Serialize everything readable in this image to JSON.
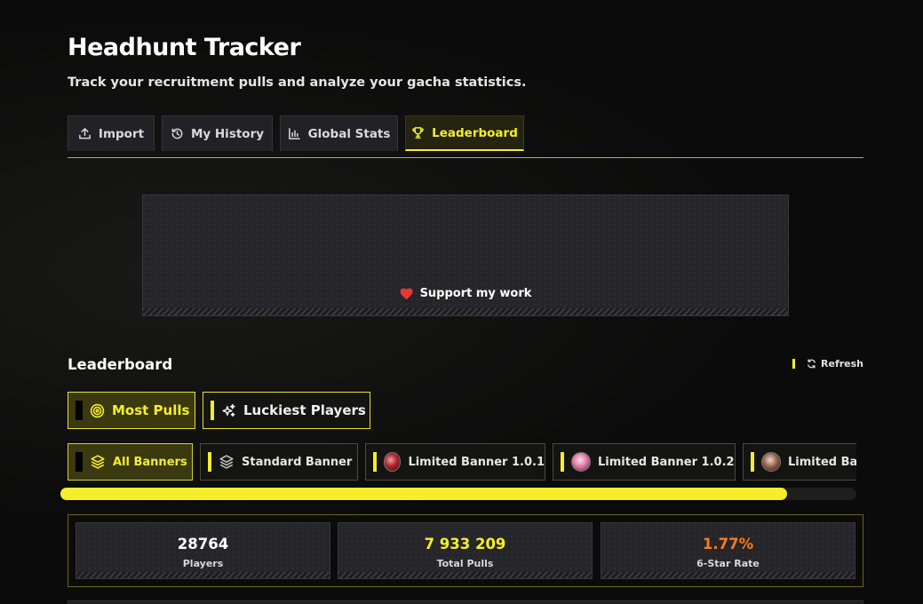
{
  "header": {
    "title": "Headhunt Tracker",
    "subtitle": "Track your recruitment pulls and analyze your gacha statistics."
  },
  "tabs": [
    {
      "label": "Import",
      "icon": "upload-icon",
      "active": false
    },
    {
      "label": "My History",
      "icon": "history-icon",
      "active": false
    },
    {
      "label": "Global Stats",
      "icon": "bar-chart-icon",
      "active": false
    },
    {
      "label": "Leaderboard",
      "icon": "trophy-icon",
      "active": true
    }
  ],
  "support": {
    "label": "Support my work",
    "icon": "heart-icon"
  },
  "leaderboard": {
    "title": "Leaderboard",
    "refresh_label": "Refresh",
    "modes": [
      {
        "label": "Most Pulls",
        "icon": "target-icon",
        "active": true
      },
      {
        "label": "Luckiest Players",
        "icon": "sparkles-icon",
        "active": false
      }
    ],
    "banners": [
      {
        "label": "All Banners",
        "icon": "layers-icon",
        "active": true
      },
      {
        "label": "Standard Banner",
        "icon": "layers-icon",
        "active": false
      },
      {
        "label": "Limited Banner 1.0.1",
        "icon": "character-avatar",
        "active": false
      },
      {
        "label": "Limited Banner 1.0.2",
        "icon": "character-avatar",
        "active": false
      },
      {
        "label": "Limited Ba",
        "icon": "character-avatar",
        "active": false
      }
    ],
    "stats": [
      {
        "value": "28764",
        "label": "Players",
        "color": "#ffffff"
      },
      {
        "value": "7 933 209",
        "label": "Total Pulls",
        "color": "#f6ee2a"
      },
      {
        "value": "1.77%",
        "label": "6-Star Rate",
        "color": "#ff7a1a"
      }
    ]
  },
  "colors": {
    "accent": "#f6ee2a",
    "background": "#0b0b0b",
    "heart": "#e53935",
    "rate": "#ff7a1a"
  }
}
